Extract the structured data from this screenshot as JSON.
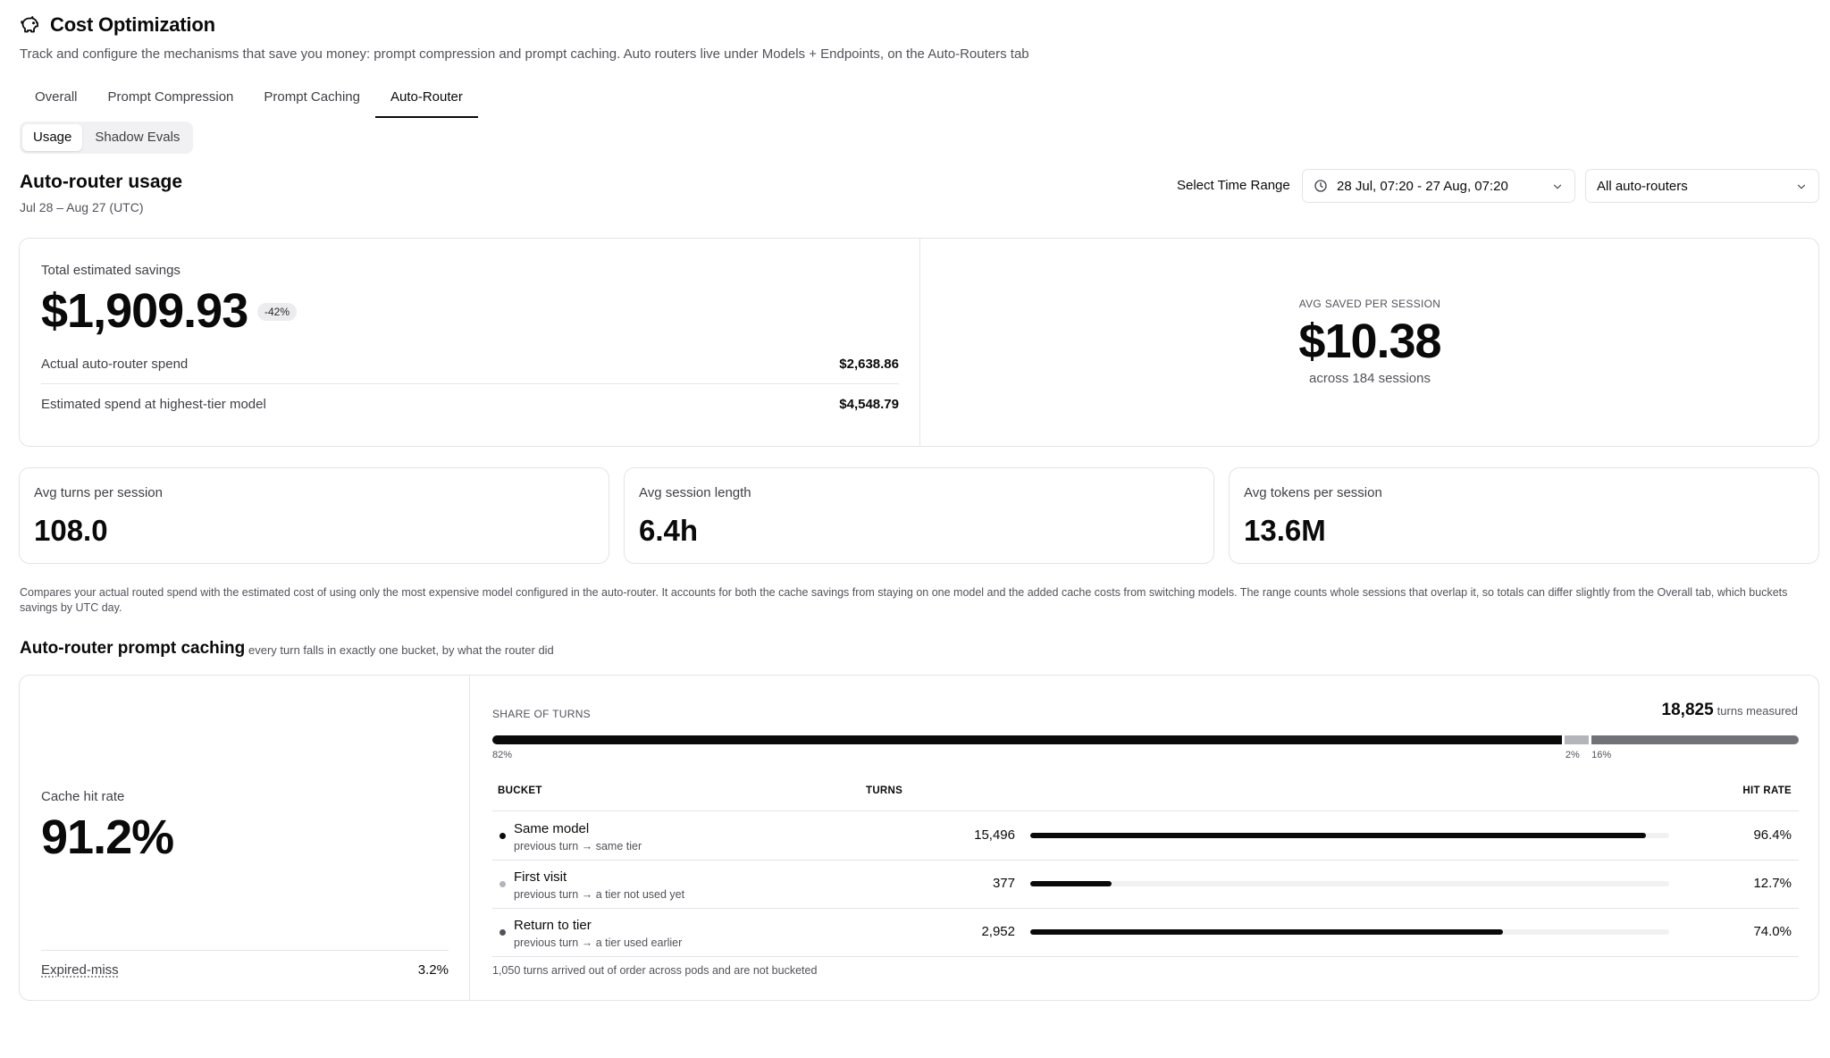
{
  "header": {
    "title": "Cost Optimization",
    "icon": "piggy-bank-icon",
    "subtitle": "Track and configure the mechanisms that save you money: prompt compression and prompt caching. Auto routers live under Models + Endpoints, on the Auto-Routers tab"
  },
  "tabs": [
    {
      "label": "Overall",
      "active": false
    },
    {
      "label": "Prompt Compression",
      "active": false
    },
    {
      "label": "Prompt Caching",
      "active": false
    },
    {
      "label": "Auto-Router",
      "active": true
    }
  ],
  "subtabs": [
    {
      "label": "Usage",
      "active": true
    },
    {
      "label": "Shadow Evals",
      "active": false
    }
  ],
  "usage": {
    "title": "Auto-router usage",
    "range": "Jul 28 – Aug 27 (UTC)"
  },
  "filters": {
    "time_label": "Select Time Range",
    "time_value": "28 Jul, 07:20 - 27 Aug, 07:20",
    "router_value": "All auto-routers"
  },
  "savings": {
    "label": "Total estimated savings",
    "value": "$1,909.93",
    "badge": "-42%",
    "actual_label": "Actual auto-router spend",
    "actual_value": "$2,638.86",
    "estimated_label": "Estimated spend at highest-tier model",
    "estimated_value": "$4,548.79",
    "avg_label": "AVG SAVED PER SESSION",
    "avg_value": "$10.38",
    "avg_sub": "across 184 sessions"
  },
  "stats": [
    {
      "label": "Avg turns per session",
      "value": "108.0"
    },
    {
      "label": "Avg session length",
      "value": "6.4h"
    },
    {
      "label": "Avg tokens per session",
      "value": "13.6M"
    }
  ],
  "footnote": "Compares your actual routed spend with the estimated cost of using only the most expensive model configured in the auto-router. It accounts for both the cache savings from staying on one model and the added cache costs from switching models. The range counts whole sessions that overlap it, so totals can differ slightly from the Overall tab, which buckets savings by UTC day.",
  "caching": {
    "title": "Auto-router prompt caching",
    "subtitle": "every turn falls in exactly one bucket, by what the router did",
    "hit_label": "Cache hit rate",
    "hit_value": "91.2%",
    "expired_label": "Expired-miss",
    "expired_value": "3.2%",
    "share_label": "SHARE OF TURNS",
    "turns_measured": "18,825",
    "turns_measured_suffix": "turns measured",
    "share": [
      {
        "pct": 82,
        "label": "82%",
        "color": "#0a0a0a"
      },
      {
        "pct": 2,
        "label": "2%",
        "color": "#b4b4bc"
      },
      {
        "pct": 16,
        "label": "16%",
        "color": "#71717a"
      }
    ],
    "columns": {
      "bucket": "BUCKET",
      "turns": "TURNS",
      "hit_rate": "HIT RATE"
    },
    "rows": [
      {
        "name": "Same model",
        "desc": "previous turn → same tier",
        "turns": "15,496",
        "hit_rate": "96.4%",
        "hit_fraction": 0.964,
        "dot": "#0a0a0a",
        "bar": "#0a0a0a"
      },
      {
        "name": "First visit",
        "desc": "previous turn → a tier not used yet",
        "turns": "377",
        "hit_rate": "12.7%",
        "hit_fraction": 0.127,
        "dot": "#b4b4bc",
        "bar": "#0a0a0a"
      },
      {
        "name": "Return to tier",
        "desc": "previous turn → a tier used earlier",
        "turns": "2,952",
        "hit_rate": "74.0%",
        "hit_fraction": 0.74,
        "dot": "#52525b",
        "bar": "#0a0a0a"
      }
    ],
    "out_of_order_note": "1,050 turns arrived out of order across pods and are not bucketed"
  }
}
